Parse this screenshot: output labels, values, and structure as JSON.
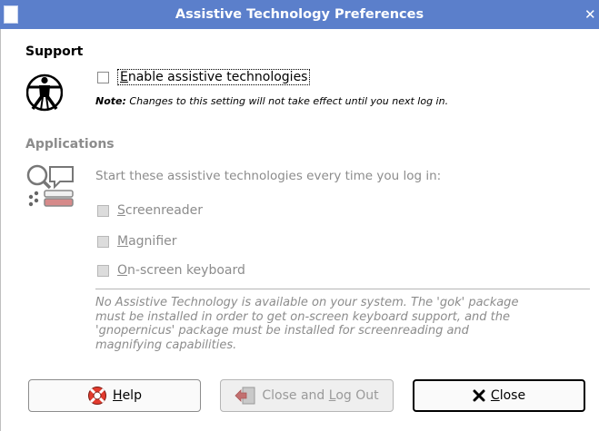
{
  "window": {
    "title": "Assistive Technology Preferences",
    "close_glyph": "✕"
  },
  "support": {
    "heading": "Support",
    "icon": "vitruvian-man-icon",
    "enable_checkbox": {
      "mnemonic": "E",
      "label_rest": "nable assistive technologies",
      "checked": false
    },
    "note_bold": "Note:",
    "note_text": " Changes to this setting will not take effect until you next log in."
  },
  "applications": {
    "heading": "Applications",
    "icon": "assistive-apps-icon",
    "intro": "Start these assistive technologies every time you log in:",
    "options": [
      {
        "mnemonic": "S",
        "rest": "creenreader",
        "checked": false,
        "enabled": false
      },
      {
        "mnemonic": "M",
        "rest": "agnifier",
        "checked": false,
        "enabled": false
      },
      {
        "mnemonic": "O",
        "rest": "n-screen keyboard",
        "checked": false,
        "enabled": false
      }
    ],
    "info": "No Assistive Technology is available on your system.  The 'gok' package must be installed in order to get on-screen keyboard support, and the 'gnopernicus' package must be installed for screenreading and magnifying capabilities."
  },
  "buttons": {
    "help": {
      "mnemonic": "H",
      "rest": "elp",
      "icon": "lifebuoy-icon"
    },
    "logout": {
      "before": "Close and ",
      "mnemonic": "L",
      "after": "og Out",
      "icon": "logout-icon",
      "enabled": false
    },
    "close": {
      "mnemonic": "C",
      "rest": "lose",
      "icon": "x-icon"
    }
  },
  "colors": {
    "titlebar": "#5b7fcb",
    "disabled_text": "#8c8c8c"
  }
}
